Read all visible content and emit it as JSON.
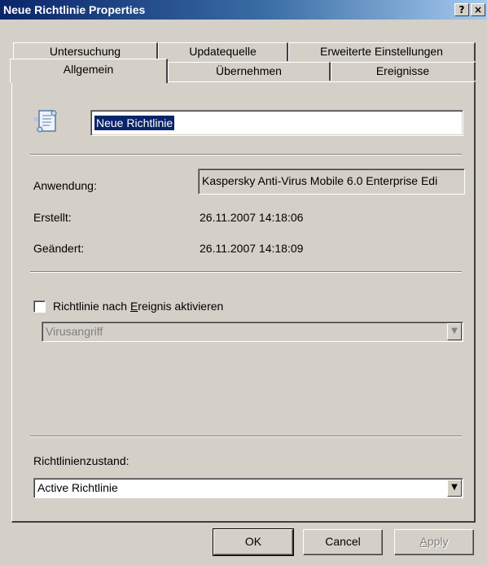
{
  "window": {
    "title": "Neue Richtlinie Properties",
    "help_glyph": "?",
    "close_glyph": "×"
  },
  "tabs": {
    "back_row": [
      "Untersuchung",
      "Updatequelle",
      "Erweiterte Einstellungen"
    ],
    "front_row": [
      "Allgemein",
      "Übernehmen",
      "Ereignisse"
    ],
    "active": "Allgemein"
  },
  "general": {
    "policy_name": "Neue Richtlinie",
    "application_label": "Anwendung:",
    "application_value": "Kaspersky Anti-Virus Mobile 6.0 Enterprise Edi",
    "created_label": "Erstellt:",
    "created_value": "26.11.2007 14:18:06",
    "modified_label": "Geändert:",
    "modified_value": "26.11.2007 14:18:09",
    "activate_on_event": {
      "label_pre": "Richtlinie nach ",
      "label_accel": "E",
      "label_post": "reignis aktivieren",
      "checked": false
    },
    "event_select": {
      "value": "Virusangriff",
      "enabled": false
    },
    "state_label": "Richtlinienzustand:",
    "state_select": {
      "value": "Active Richtlinie"
    }
  },
  "buttons": {
    "ok": "OK",
    "cancel": "Cancel",
    "apply_accel": "A",
    "apply_rest": "pply"
  },
  "icons": {
    "policy": "scroll-document-icon",
    "dropdown": "chevron-down-icon"
  },
  "colors": {
    "face": "#d4d0c8",
    "title_active": "#0a246a",
    "selection": "#0a246a",
    "disabled_text": "#808080"
  }
}
